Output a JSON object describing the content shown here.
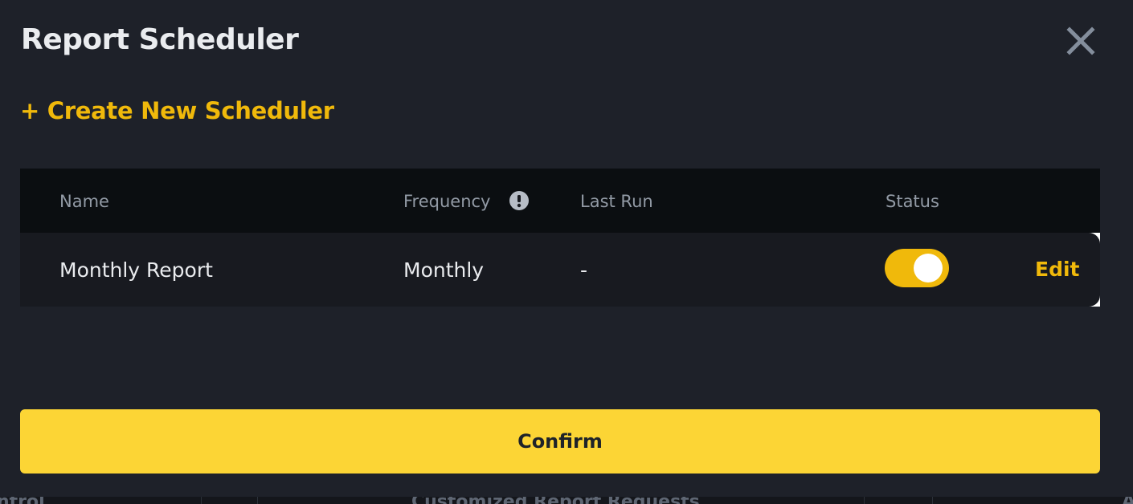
{
  "dialog": {
    "title": "Report Scheduler",
    "create_link": "+ Create New Scheduler"
  },
  "table": {
    "headers": {
      "name": "Name",
      "frequency": "Frequency",
      "last_run": "Last Run",
      "status": "Status"
    },
    "rows": [
      {
        "name": "Monthly Report",
        "frequency": "Monthly",
        "last_run": "-",
        "status_enabled": true,
        "action": "Edit"
      }
    ]
  },
  "footer": {
    "confirm_label": "Confirm"
  },
  "background": {
    "left_text": "ntrol",
    "center_text": "Customized Report Requests",
    "right_text": "A"
  },
  "icons": {
    "close": "close-icon",
    "info": "info-icon"
  },
  "colors": {
    "modal_bg": "#1e2129",
    "header_bg": "#0b0e11",
    "row_bg": "#181a20",
    "accent": "#f0b90b",
    "button": "#fcd535",
    "text_primary": "#eaecef",
    "text_secondary": "#929aa5"
  }
}
